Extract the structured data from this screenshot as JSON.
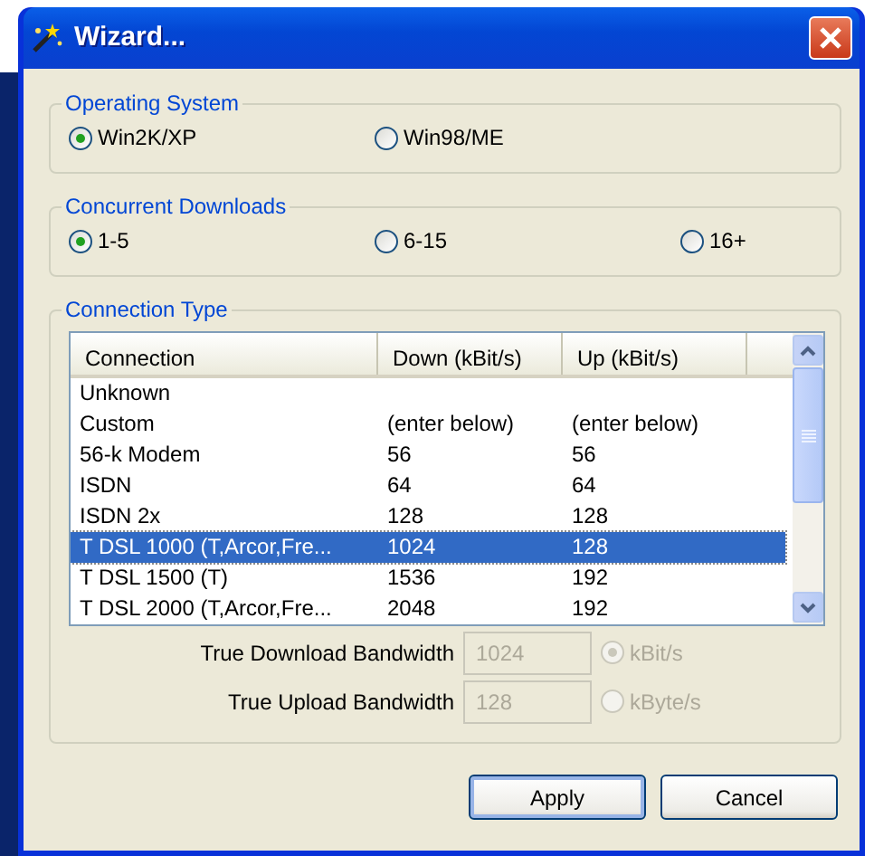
{
  "window": {
    "title": "Wizard..."
  },
  "groups": [
    {
      "title": "Operating System",
      "options": [
        {
          "label": "Win2K/XP",
          "selected": true
        },
        {
          "label": "Win98/ME",
          "selected": false
        }
      ]
    },
    {
      "title": "Concurrent Downloads",
      "options": [
        {
          "label": "1-5",
          "selected": true
        },
        {
          "label": "6-15",
          "selected": false
        },
        {
          "label": "16+",
          "selected": false
        }
      ]
    }
  ],
  "connection_type": {
    "title": "Connection Type",
    "columns": [
      "Connection",
      "Down (kBit/s)",
      "Up (kBit/s)"
    ],
    "rows": [
      {
        "cells": [
          "Unknown"
        ],
        "selected": false
      },
      {
        "cells": [
          "Custom",
          "(enter below)",
          "(enter below)"
        ],
        "selected": false
      },
      {
        "cells": [
          "56-k Modem",
          "56",
          "56"
        ],
        "selected": false
      },
      {
        "cells": [
          "ISDN",
          "64",
          "64"
        ],
        "selected": false
      },
      {
        "cells": [
          "ISDN 2x",
          "128",
          "128"
        ],
        "selected": false
      },
      {
        "cells": [
          "T DSL 1000 (T,Arcor,Fre...",
          "1024",
          "128"
        ],
        "selected": true
      },
      {
        "cells": [
          "T DSL 1500 (T)",
          "1536",
          "192"
        ],
        "selected": false
      },
      {
        "cells": [
          "T DSL 2000 (T,Arcor,Fre...",
          "2048",
          "192"
        ],
        "selected": false
      }
    ],
    "fields": [
      {
        "label": "True Download Bandwidth",
        "value": "1024",
        "disabled": true,
        "unit": {
          "label": "kBit/s",
          "selected": true,
          "disabled": true
        }
      },
      {
        "label": "True Upload Bandwidth",
        "value": "128",
        "disabled": true,
        "unit": {
          "label": "kByte/s",
          "selected": false,
          "disabled": true
        }
      }
    ]
  },
  "buttons": [
    {
      "label": "Apply",
      "default": true
    },
    {
      "label": "Cancel",
      "default": false
    }
  ]
}
